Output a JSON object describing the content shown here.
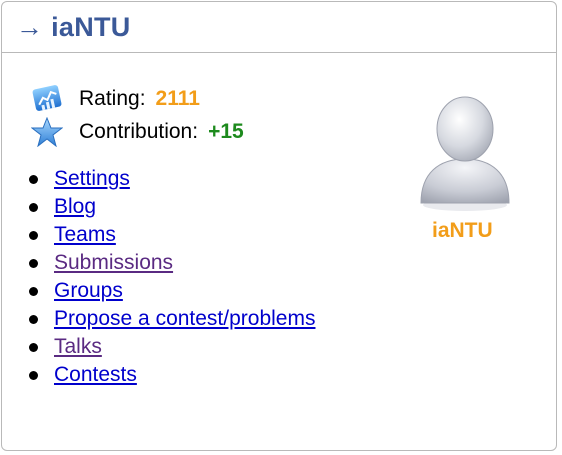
{
  "header": {
    "title": "→ iaNTU"
  },
  "stats": {
    "rating_label": "Rating:",
    "rating_value": "2111",
    "contribution_label": "Contribution:",
    "contribution_value": "+15"
  },
  "nav": {
    "items": [
      {
        "label": "Settings",
        "visited": false
      },
      {
        "label": "Blog",
        "visited": false
      },
      {
        "label": "Teams",
        "visited": false
      },
      {
        "label": "Submissions",
        "visited": true
      },
      {
        "label": "Groups",
        "visited": false
      },
      {
        "label": "Propose a contest/problems",
        "visited": false
      },
      {
        "label": "Talks",
        "visited": true
      },
      {
        "label": "Contests",
        "visited": false
      }
    ]
  },
  "profile": {
    "username": "iaNTU",
    "avatar_icon": "user-silhouette-icon"
  },
  "colors": {
    "title": "#3b5998",
    "rating": "#f29d19",
    "contribution": "#1d8a1d",
    "link": "#0000cc",
    "link_visited": "#5a2a82"
  }
}
